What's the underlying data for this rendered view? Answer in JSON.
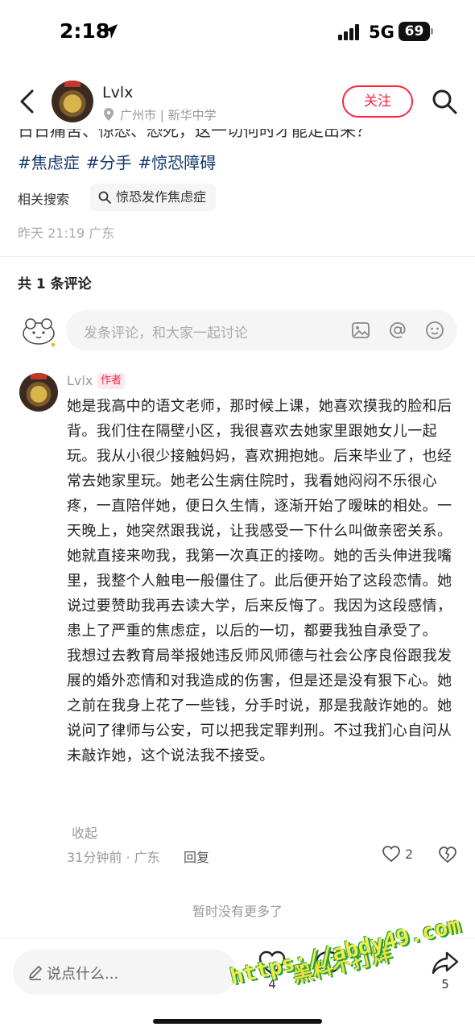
{
  "status_bar": {
    "time": "2:18",
    "network": "5G",
    "battery": "69"
  },
  "header": {
    "author": "Lvlx",
    "location": "广州市 | 新华中学",
    "follow_label": "关注"
  },
  "note": {
    "cut_line": "日日痛苦、惊恐、恐死，这一切何时才能走出来？",
    "tags": [
      "#焦虑症",
      "#分手",
      "#惊恐障碍"
    ],
    "related_label": "相关搜索",
    "related_query": "惊恐发作焦虑症",
    "post_time": "昨天 21:19  广东"
  },
  "comments_header": "共 1 条评论",
  "comment_input_placeholder": "发条评论，和大家一起讨论",
  "comment": {
    "name": "Lvlx",
    "badge": "作者",
    "paragraphs": [
      "她是我高中的语文老师，那时候上课，她喜欢摸我的脸和后背。我们住在隔壁小区，我很喜欢去她家里跟她女儿一起玩。我从小很少接触妈妈，喜欢拥抱她。后来毕业了，也经常去她家里玩。她老公生病住院时，我看她闷闷不乐很心疼，一直陪伴她，便日久生情，逐渐开始了暧昧的相处。一天晚上，她突然跟我说，让我感受一下什么叫做亲密关系。她就直接来吻我，我第一次真正的接吻。她的舌头伸进我嘴里，我整个人触电一般僵住了。此后便开始了这段恋情。她说过要赞助我再去读大学，后来反悔了。我因为这段感情，患上了严重的焦虑症，以后的一切，都要我独自承受了。",
      "我想过去教育局举报她违反师风师德与社会公序良俗跟我发展的婚外恋情和对我造成的伤害，但是还是没有狠下心。她之前在我身上花了一些钱，分手时说，那是我敲诈她的。她说问了律师与公安，可以把我定罪判刑。不过我扪心自问从未敲诈她，这个说法我不接受。"
    ],
    "collapse_label": "收起",
    "meta": "31分钟前 · 广东",
    "reply_label": "回复",
    "likes": "2"
  },
  "no_more_text": "暂时没有更多了",
  "bottom_bar": {
    "input_placeholder": "说点什么...",
    "like_count": "4",
    "share_count": "5"
  },
  "watermark": {
    "line1": "黑料不打烊",
    "line2": "https://abdy49.com"
  },
  "colors": {
    "accent": "#ff2442",
    "tag": "#13386c",
    "muted": "#999999"
  }
}
